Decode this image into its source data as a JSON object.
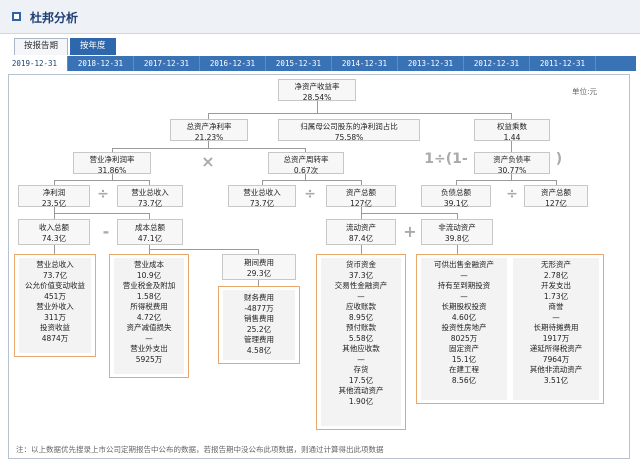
{
  "header": {
    "title": "杜邦分析"
  },
  "report_tabs": [
    "按报告期",
    "按年度"
  ],
  "date_tabs": [
    "2019-12-31",
    "2018-12-31",
    "2017-12-31",
    "2016-12-31",
    "2015-12-31",
    "2014-12-31",
    "2013-12-31",
    "2012-12-31",
    "2011-12-31"
  ],
  "unit": "单位:元",
  "top": {
    "label": "净资产收益率",
    "value": "28.54%"
  },
  "row2": [
    {
      "label": "总资产净利率",
      "value": "21.23%"
    },
    {
      "label": "归属母公司股东的净利润占比",
      "value": "75.58%"
    },
    {
      "label": "权益乘数",
      "value": "1.44"
    }
  ],
  "row3": [
    {
      "label": "营业净利润率",
      "value": "31.86%"
    },
    {
      "label": "总资产周转率",
      "value": "0.67次"
    },
    {
      "label": "资产负债率",
      "value": "30.77%"
    }
  ],
  "ops": {
    "times": "×",
    "div": "÷",
    "minus": "-",
    "plus": "+",
    "formula_left": "1÷(1-",
    "formula_right": ")"
  },
  "row4": [
    {
      "label": "净利润",
      "value": "23.5亿"
    },
    {
      "label": "营业总收入",
      "value": "73.7亿"
    },
    {
      "label": "营业总收入",
      "value": "73.7亿"
    },
    {
      "label": "资产总额",
      "value": "127亿"
    },
    {
      "label": "负债总额",
      "value": "39.1亿"
    },
    {
      "label": "资产总额",
      "value": "127亿"
    }
  ],
  "row5": [
    {
      "label": "收入总额",
      "value": "74.3亿"
    },
    {
      "label": "成本总额",
      "value": "47.1亿"
    },
    {
      "label": "流动资产",
      "value": "87.4亿"
    },
    {
      "label": "非流动资产",
      "value": "39.8亿"
    }
  ],
  "income_items": [
    "营业总收入",
    "73.7亿",
    "公允价值变动收益",
    "451万",
    "营业外收入",
    "311万",
    "投资收益",
    "4874万"
  ],
  "cost_items": [
    "营业成本",
    "10.9亿",
    "营业税金及附加",
    "1.58亿",
    "所得税费用",
    "4.72亿",
    "资产减值损失",
    "—",
    "营业外支出",
    "5925万"
  ],
  "period_fee": {
    "label": "期间费用",
    "value": "29.3亿"
  },
  "fee_items": [
    "财务费用",
    "-4877万",
    "销售费用",
    "25.2亿",
    "管理费用",
    "4.58亿"
  ],
  "current_items": [
    "货币资金",
    "37.3亿",
    "交易性金融资产",
    "—",
    "应收账款",
    "8.95亿",
    "预付账款",
    "5.58亿",
    "其他应收款",
    "—",
    "存货",
    "17.5亿",
    "其他流动资产",
    "1.90亿"
  ],
  "noncurrent_left": [
    "可供出售金融资产",
    "—",
    "持有至到期投资",
    "—",
    "长期股权投资",
    "4.60亿",
    "投资性房地产",
    "8025万",
    "固定资产",
    "15.1亿",
    "在建工程",
    "8.56亿"
  ],
  "noncurrent_right": [
    "无形资产",
    "2.78亿",
    "开发支出",
    "1.73亿",
    "商誉",
    "—",
    "长期待摊费用",
    "1917万",
    "递延所得税资产",
    "7964万",
    "其他非流动资产",
    "3.51亿"
  ],
  "note": "注：以上数据优先搜录上市公司定期报告中公布的数据，若报告期中没公布此项数据，则通过计算得出此项数据"
}
